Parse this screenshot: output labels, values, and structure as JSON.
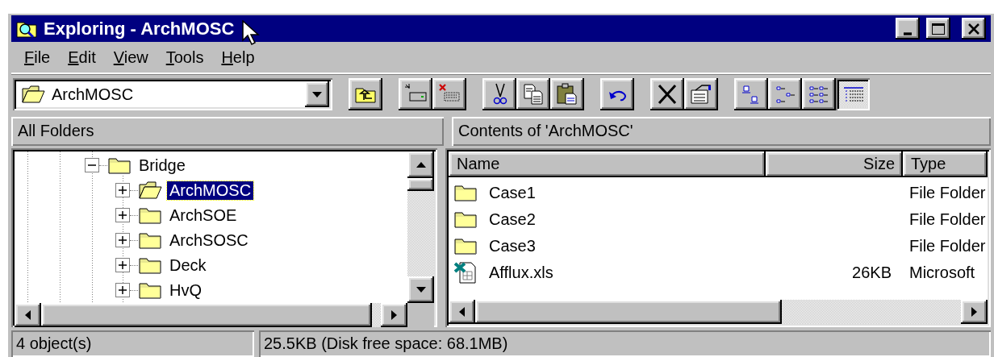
{
  "window": {
    "title": "Exploring - ArchMOSC"
  },
  "menu": [
    "File",
    "Edit",
    "View",
    "Tools",
    "Help"
  ],
  "address": {
    "value": "ArchMOSC"
  },
  "toolbar": [
    [
      {
        "kind": "up-folder",
        "selected": false
      }
    ],
    [
      {
        "kind": "map-drive",
        "selected": false
      },
      {
        "kind": "disconnect",
        "selected": false
      }
    ],
    [
      {
        "kind": "cut",
        "selected": false
      },
      {
        "kind": "copy",
        "selected": false
      },
      {
        "kind": "paste",
        "selected": false
      }
    ],
    [
      {
        "kind": "undo",
        "selected": false
      }
    ],
    [
      {
        "kind": "delete",
        "selected": false
      },
      {
        "kind": "properties",
        "selected": false
      }
    ],
    [
      {
        "kind": "large-icons",
        "selected": false
      },
      {
        "kind": "small-icons",
        "selected": false
      },
      {
        "kind": "list",
        "selected": false
      },
      {
        "kind": "details",
        "selected": true
      }
    ]
  ],
  "folders_header": "All Folders",
  "contents_header": "Contents of 'ArchMOSC'",
  "tree": [
    {
      "label": "Bridge",
      "expanded": true,
      "selected": false,
      "children": [
        {
          "label": "ArchMOSC",
          "expanded": false,
          "selected": true
        },
        {
          "label": "ArchSOE",
          "expanded": false,
          "selected": false
        },
        {
          "label": "ArchSOSC",
          "expanded": false,
          "selected": false
        },
        {
          "label": "Deck",
          "expanded": false,
          "selected": false
        },
        {
          "label": "HvQ",
          "expanded": false,
          "selected": false
        }
      ]
    }
  ],
  "columns": [
    "Name",
    "Size",
    "Type"
  ],
  "rows": [
    {
      "kind": "folder",
      "name": "Case1",
      "type": "File Folder"
    },
    {
      "kind": "folder",
      "name": "Case2",
      "type": "File Folder"
    },
    {
      "kind": "folder",
      "name": "Case3",
      "type": "File Folder"
    },
    {
      "kind": "spreadsheet",
      "name": "Afflux.xls",
      "size": "26KB",
      "type": "Microsoft"
    }
  ],
  "status_bar": [
    "4 object(s)",
    "25.5KB (Disk free space: 68.1MB)"
  ]
}
